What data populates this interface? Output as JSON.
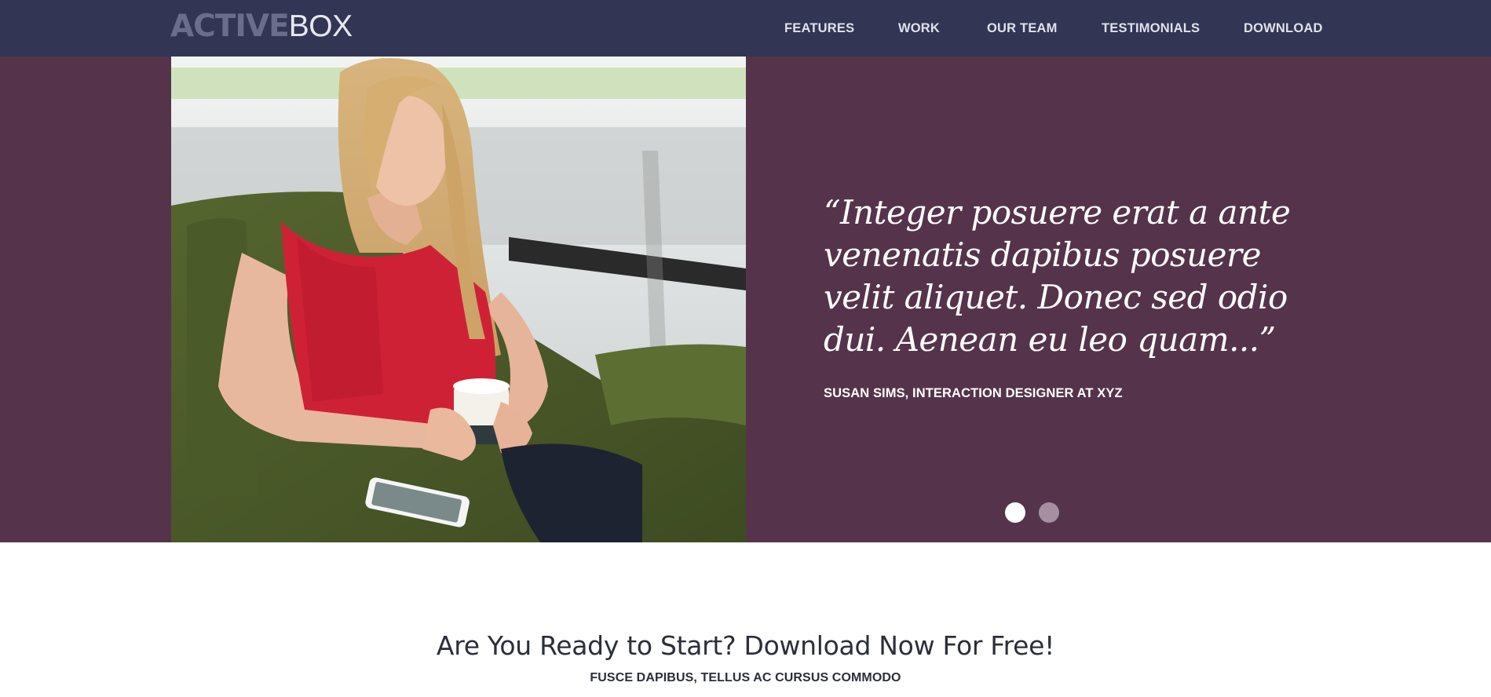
{
  "header": {
    "logo": {
      "bold_part": "ACTIVE",
      "light_part": "BOX"
    },
    "nav": [
      {
        "label": "FEATURES"
      },
      {
        "label": "WORK"
      },
      {
        "label": "OUR TEAM"
      },
      {
        "label": "TESTIMONIALS"
      },
      {
        "label": "DOWNLOAD"
      }
    ]
  },
  "testimonial": {
    "photo_subject": "woman-in-red-top-holding-coffee-cup",
    "quote": "“Integer posuere erat a ante venenatis dapibus posuere velit aliquet. Donec sed odio dui. Aenean eu leo quam...”",
    "author": "SUSAN SIMS, INTERACTION DESIGNER AT XYZ",
    "slides": {
      "count": 2,
      "active": 1
    }
  },
  "cta": {
    "title": "Are You Ready to Start? Download Now For Free!",
    "subtitle": "FUSCE DAPIBUS, TELLUS AC CURSUS COMMODO"
  },
  "colors": {
    "header_bg": "#323553",
    "testimonial_bg": "#55344b",
    "logo_bold": "#6a6e8c",
    "dot_active": "#ffffff",
    "dot_inactive": "#a58fa0"
  }
}
